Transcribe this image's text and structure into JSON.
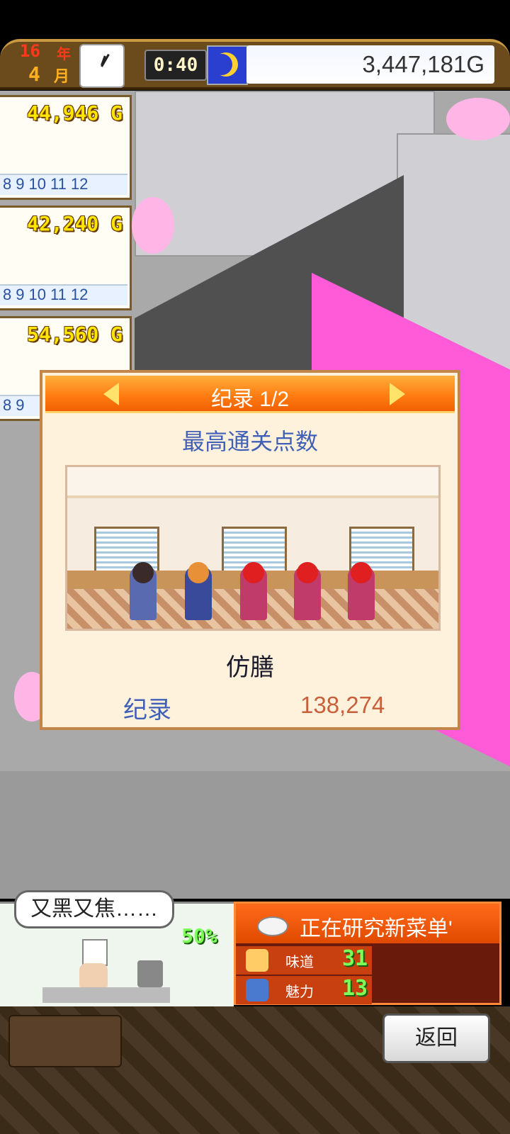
{
  "topbar": {
    "year_number": "16",
    "year_unit": "年",
    "month_number": "4",
    "month_unit": "月",
    "time": "0:40",
    "money": "3,447,181G"
  },
  "side_panels": [
    {
      "amount": "44,946 G",
      "months": [
        "8",
        "9",
        "10",
        "11",
        "12"
      ]
    },
    {
      "amount": "42,240 G",
      "months": [
        "8",
        "9",
        "10",
        "11",
        "12"
      ]
    },
    {
      "amount": "54,560 G",
      "months": [
        "8",
        "9"
      ]
    }
  ],
  "dialog": {
    "title": "纪录 1/2",
    "subtitle": "最高通关点数",
    "name": "仿膳",
    "record_label": "纪录",
    "record_value": "138,274"
  },
  "kitchen": {
    "speech": "又黑又焦……",
    "progress": "50%"
  },
  "research": {
    "title": "正在研究新菜单'",
    "stats": [
      {
        "label": "味道",
        "value": "31"
      },
      {
        "label": "魅力",
        "value": "13"
      }
    ]
  },
  "footer": {
    "back_label": "返回"
  },
  "colors": {
    "accent_orange": "#ff7a10",
    "dialog_bg": "#fff2dc",
    "title_blue": "#4060b8",
    "record_value": "#c8603a"
  }
}
